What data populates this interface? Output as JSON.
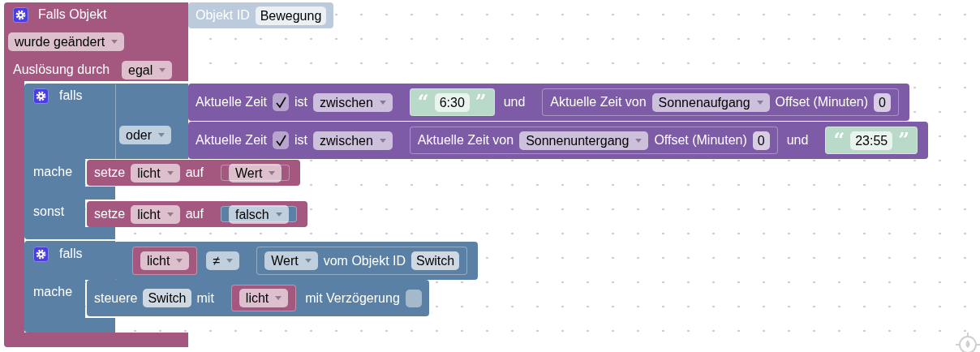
{
  "event_block": {
    "title": "Falls Objekt",
    "event": "wurde geändert",
    "trigger_label": "Auslösung durch",
    "trigger": "egal",
    "object": {
      "kind": "object_block",
      "parts": [
        {
          "kind": "text",
          "text": "Objekt ID"
        },
        {
          "kind": "field",
          "text": "Bewegung"
        }
      ]
    }
  },
  "if_blocks": [
    {
      "if_label": "falls",
      "conditions": [
        {
          "kind": "time_block",
          "parts": [
            {
              "kind": "text",
              "text": "Aktuelle Zeit"
            },
            {
              "kind": "checkbox",
              "checked": true
            },
            {
              "kind": "text",
              "text": "ist"
            },
            {
              "kind": "dropdown",
              "text": "zwischen"
            },
            {
              "kind": "string_block",
              "parts": [
                {
                  "kind": "quote",
                  "text": "“"
                },
                {
                  "kind": "field",
                  "text": "6:30"
                },
                {
                  "kind": "quote",
                  "text": "”"
                }
              ]
            },
            {
              "kind": "text",
              "text": "und"
            },
            {
              "kind": "time_block",
              "parts": [
                {
                  "kind": "text",
                  "text": "Aktuelle Zeit von"
                },
                {
                  "kind": "dropdown",
                  "text": "Sonnenaufgang"
                },
                {
                  "kind": "text",
                  "text": "Offset (Minuten)"
                },
                {
                  "kind": "field",
                  "text": "0"
                }
              ]
            }
          ]
        },
        {
          "connector": "oder",
          "kind": "time_block",
          "parts": [
            {
              "kind": "text",
              "text": "Aktuelle Zeit"
            },
            {
              "kind": "checkbox",
              "checked": true
            },
            {
              "kind": "text",
              "text": "ist"
            },
            {
              "kind": "dropdown",
              "text": "zwischen"
            },
            {
              "kind": "time_block",
              "parts": [
                {
                  "kind": "text",
                  "text": "Aktuelle Zeit von"
                },
                {
                  "kind": "dropdown",
                  "text": "Sonnenuntergang"
                },
                {
                  "kind": "text",
                  "text": "Offset (Minuten)"
                },
                {
                  "kind": "field",
                  "text": "0"
                }
              ]
            },
            {
              "kind": "text",
              "text": "und"
            },
            {
              "kind": "string_block",
              "parts": [
                {
                  "kind": "quote",
                  "text": "“"
                },
                {
                  "kind": "field",
                  "text": "23:55"
                },
                {
                  "kind": "quote",
                  "text": "”"
                }
              ]
            }
          ]
        }
      ],
      "then_label": "mache",
      "then": {
        "kind": "variable_block",
        "parts": [
          {
            "kind": "text",
            "text": "setze"
          },
          {
            "kind": "dropdown",
            "text": "licht"
          },
          {
            "kind": "text",
            "text": "auf"
          },
          {
            "kind": "variable_block",
            "parts": [
              {
                "kind": "dropdown",
                "text": "Wert"
              }
            ]
          }
        ]
      },
      "else_label": "sonst",
      "else": {
        "kind": "variable_block",
        "parts": [
          {
            "kind": "text",
            "text": "setze"
          },
          {
            "kind": "dropdown",
            "text": "licht"
          },
          {
            "kind": "text",
            "text": "auf"
          },
          {
            "kind": "logic_block",
            "parts": [
              {
                "kind": "dropdown",
                "text": "falsch"
              }
            ]
          }
        ]
      }
    },
    {
      "if_label": "falls",
      "conditions": [
        {
          "kind": "logic_block",
          "parts": [
            {
              "kind": "variable_block",
              "parts": [
                {
                  "kind": "dropdown",
                  "text": "licht"
                }
              ]
            },
            {
              "kind": "dropdown",
              "text": "≠"
            },
            {
              "kind": "logic_block",
              "parts": [
                {
                  "kind": "dropdown",
                  "text": "Wert"
                },
                {
                  "kind": "text",
                  "text": "vom Objekt ID"
                },
                {
                  "kind": "field",
                  "text": "Switch"
                }
              ]
            }
          ]
        }
      ],
      "then_label": "mache",
      "then": {
        "kind": "logic_block",
        "parts": [
          {
            "kind": "text",
            "text": "steuere"
          },
          {
            "kind": "field",
            "text": "Switch"
          },
          {
            "kind": "text",
            "text": "mit"
          },
          {
            "kind": "variable_block",
            "parts": [
              {
                "kind": "dropdown",
                "text": "licht"
              }
            ]
          },
          {
            "kind": "text",
            "text": "mit Verzögerung"
          },
          {
            "kind": "checkbox",
            "checked": false
          }
        ]
      }
    }
  ]
}
